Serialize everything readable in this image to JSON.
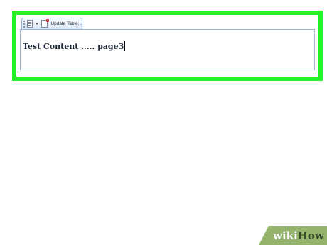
{
  "toc_toolbar": {
    "document_icon": "document-icon",
    "update_icon": "update-table-icon",
    "update_label": "Update Table..."
  },
  "toc_content": {
    "entry_text": "Test Content ..... page3"
  },
  "watermark": {
    "wiki": "wiki",
    "how": "How"
  },
  "colors": {
    "highlight": "#22f322",
    "toolbar_border": "#8fb3d9",
    "watermark_bg": "#93b46a"
  }
}
